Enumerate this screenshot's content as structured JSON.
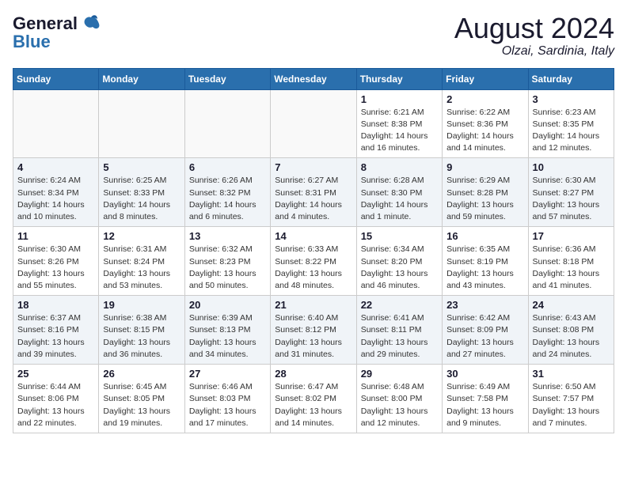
{
  "logo": {
    "line1": "General",
    "line2": "Blue",
    "bird_unicode": "🐦"
  },
  "title": {
    "month_year": "August 2024",
    "location": "Olzai, Sardinia, Italy"
  },
  "weekdays": [
    "Sunday",
    "Monday",
    "Tuesday",
    "Wednesday",
    "Thursday",
    "Friday",
    "Saturday"
  ],
  "weeks": [
    [
      {
        "day": "",
        "info": ""
      },
      {
        "day": "",
        "info": ""
      },
      {
        "day": "",
        "info": ""
      },
      {
        "day": "",
        "info": ""
      },
      {
        "day": "1",
        "info": "Sunrise: 6:21 AM\nSunset: 8:38 PM\nDaylight: 14 hours\nand 16 minutes."
      },
      {
        "day": "2",
        "info": "Sunrise: 6:22 AM\nSunset: 8:36 PM\nDaylight: 14 hours\nand 14 minutes."
      },
      {
        "day": "3",
        "info": "Sunrise: 6:23 AM\nSunset: 8:35 PM\nDaylight: 14 hours\nand 12 minutes."
      }
    ],
    [
      {
        "day": "4",
        "info": "Sunrise: 6:24 AM\nSunset: 8:34 PM\nDaylight: 14 hours\nand 10 minutes."
      },
      {
        "day": "5",
        "info": "Sunrise: 6:25 AM\nSunset: 8:33 PM\nDaylight: 14 hours\nand 8 minutes."
      },
      {
        "day": "6",
        "info": "Sunrise: 6:26 AM\nSunset: 8:32 PM\nDaylight: 14 hours\nand 6 minutes."
      },
      {
        "day": "7",
        "info": "Sunrise: 6:27 AM\nSunset: 8:31 PM\nDaylight: 14 hours\nand 4 minutes."
      },
      {
        "day": "8",
        "info": "Sunrise: 6:28 AM\nSunset: 8:30 PM\nDaylight: 14 hours\nand 1 minute."
      },
      {
        "day": "9",
        "info": "Sunrise: 6:29 AM\nSunset: 8:28 PM\nDaylight: 13 hours\nand 59 minutes."
      },
      {
        "day": "10",
        "info": "Sunrise: 6:30 AM\nSunset: 8:27 PM\nDaylight: 13 hours\nand 57 minutes."
      }
    ],
    [
      {
        "day": "11",
        "info": "Sunrise: 6:30 AM\nSunset: 8:26 PM\nDaylight: 13 hours\nand 55 minutes."
      },
      {
        "day": "12",
        "info": "Sunrise: 6:31 AM\nSunset: 8:24 PM\nDaylight: 13 hours\nand 53 minutes."
      },
      {
        "day": "13",
        "info": "Sunrise: 6:32 AM\nSunset: 8:23 PM\nDaylight: 13 hours\nand 50 minutes."
      },
      {
        "day": "14",
        "info": "Sunrise: 6:33 AM\nSunset: 8:22 PM\nDaylight: 13 hours\nand 48 minutes."
      },
      {
        "day": "15",
        "info": "Sunrise: 6:34 AM\nSunset: 8:20 PM\nDaylight: 13 hours\nand 46 minutes."
      },
      {
        "day": "16",
        "info": "Sunrise: 6:35 AM\nSunset: 8:19 PM\nDaylight: 13 hours\nand 43 minutes."
      },
      {
        "day": "17",
        "info": "Sunrise: 6:36 AM\nSunset: 8:18 PM\nDaylight: 13 hours\nand 41 minutes."
      }
    ],
    [
      {
        "day": "18",
        "info": "Sunrise: 6:37 AM\nSunset: 8:16 PM\nDaylight: 13 hours\nand 39 minutes."
      },
      {
        "day": "19",
        "info": "Sunrise: 6:38 AM\nSunset: 8:15 PM\nDaylight: 13 hours\nand 36 minutes."
      },
      {
        "day": "20",
        "info": "Sunrise: 6:39 AM\nSunset: 8:13 PM\nDaylight: 13 hours\nand 34 minutes."
      },
      {
        "day": "21",
        "info": "Sunrise: 6:40 AM\nSunset: 8:12 PM\nDaylight: 13 hours\nand 31 minutes."
      },
      {
        "day": "22",
        "info": "Sunrise: 6:41 AM\nSunset: 8:11 PM\nDaylight: 13 hours\nand 29 minutes."
      },
      {
        "day": "23",
        "info": "Sunrise: 6:42 AM\nSunset: 8:09 PM\nDaylight: 13 hours\nand 27 minutes."
      },
      {
        "day": "24",
        "info": "Sunrise: 6:43 AM\nSunset: 8:08 PM\nDaylight: 13 hours\nand 24 minutes."
      }
    ],
    [
      {
        "day": "25",
        "info": "Sunrise: 6:44 AM\nSunset: 8:06 PM\nDaylight: 13 hours\nand 22 minutes."
      },
      {
        "day": "26",
        "info": "Sunrise: 6:45 AM\nSunset: 8:05 PM\nDaylight: 13 hours\nand 19 minutes."
      },
      {
        "day": "27",
        "info": "Sunrise: 6:46 AM\nSunset: 8:03 PM\nDaylight: 13 hours\nand 17 minutes."
      },
      {
        "day": "28",
        "info": "Sunrise: 6:47 AM\nSunset: 8:02 PM\nDaylight: 13 hours\nand 14 minutes."
      },
      {
        "day": "29",
        "info": "Sunrise: 6:48 AM\nSunset: 8:00 PM\nDaylight: 13 hours\nand 12 minutes."
      },
      {
        "day": "30",
        "info": "Sunrise: 6:49 AM\nSunset: 7:58 PM\nDaylight: 13 hours\nand 9 minutes."
      },
      {
        "day": "31",
        "info": "Sunrise: 6:50 AM\nSunset: 7:57 PM\nDaylight: 13 hours\nand 7 minutes."
      }
    ]
  ]
}
